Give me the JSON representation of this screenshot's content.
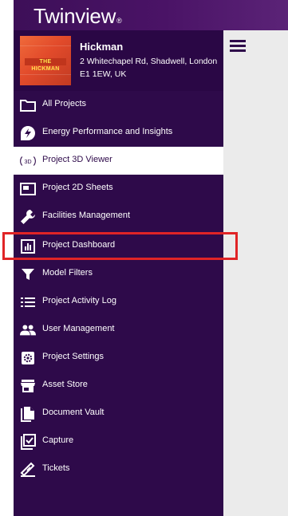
{
  "app": {
    "logo_text": "Twinview",
    "logo_mark": "®"
  },
  "project": {
    "name": "Hickman",
    "address": "2 Whitechapel Rd, Shadwell, London E1 1EW, UK",
    "thumbnail_text": "THE HICKMAN"
  },
  "nav": {
    "items": [
      {
        "label": "All Projects",
        "icon": "folder-icon"
      },
      {
        "label": "Energy Performance and Insights",
        "icon": "energy-icon"
      },
      {
        "label": "Project 3D Viewer",
        "icon": "3d-icon",
        "active": true
      },
      {
        "label": "Project 2D Sheets",
        "icon": "sheet-icon"
      },
      {
        "label": "Facilities Management",
        "icon": "wrench-icon"
      },
      {
        "label": "Project Dashboard",
        "icon": "dashboard-icon",
        "highlighted": true
      },
      {
        "label": "Model Filters",
        "icon": "filter-icon"
      },
      {
        "label": "Project Activity Log",
        "icon": "list-icon"
      },
      {
        "label": "User Management",
        "icon": "users-icon"
      },
      {
        "label": "Project Settings",
        "icon": "settings-icon"
      },
      {
        "label": "Asset Store",
        "icon": "store-icon"
      },
      {
        "label": "Document Vault",
        "icon": "documents-icon"
      },
      {
        "label": "Capture",
        "icon": "capture-icon"
      },
      {
        "label": "Tickets",
        "icon": "ticket-icon"
      }
    ]
  },
  "colors": {
    "sidebar_bg": "#2e0a4a",
    "topbar_bg": "#4a1366",
    "active_bg": "#ffffff",
    "highlight_border": "#e02426",
    "content_bg": "#ebebeb"
  }
}
